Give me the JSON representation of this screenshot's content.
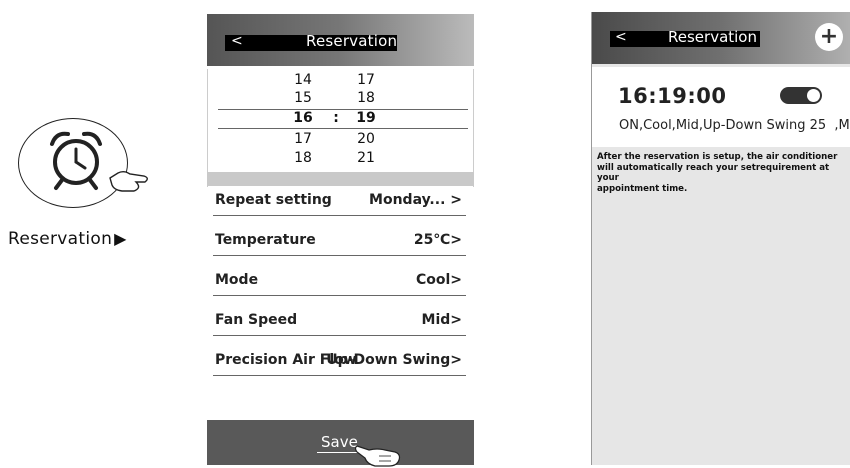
{
  "caption": {
    "label": "Reservation",
    "arrow": "▶"
  },
  "icons": {
    "alarm": "alarm-clock-icon",
    "hand": "hand-pointer-icon",
    "add": "plus-icon"
  },
  "phone1": {
    "back_label": "<",
    "title": "Reservation",
    "time_picker": {
      "rows": [
        {
          "hour": "14",
          "minute": "17"
        },
        {
          "hour": "15",
          "minute": "18"
        },
        {
          "hour": "16",
          "sep": ":",
          "minute": "19"
        },
        {
          "hour": "17",
          "minute": "20"
        },
        {
          "hour": "18",
          "minute": "21"
        }
      ]
    },
    "settings": [
      {
        "label": "Repeat setting",
        "value": "Monday... >"
      },
      {
        "label": "Temperature",
        "value": "25℃>"
      },
      {
        "label": "Mode",
        "value": "Cool>"
      },
      {
        "label": "Fan Speed",
        "value": "Mid>"
      },
      {
        "label": "Precision Air Flow",
        "value": "Up-Down Swing>"
      }
    ],
    "save_label": "Save"
  },
  "phone2": {
    "back_label": "<",
    "title": "Reservation",
    "add_label": "+",
    "card": {
      "time": "16:19:00",
      "toggle_on": true,
      "summary": "ON,Cool,Mid,Up-Down Swing 25  ,M..."
    },
    "note": "After the reservation is setup, the air conditioner\nwill automatically reach your setrequirement at your\nappointment time."
  },
  "colors": {
    "header_dark": "#555555",
    "footer": "#595959",
    "band": "#c9c9c9",
    "phone2_bg": "#e6e6e6"
  }
}
